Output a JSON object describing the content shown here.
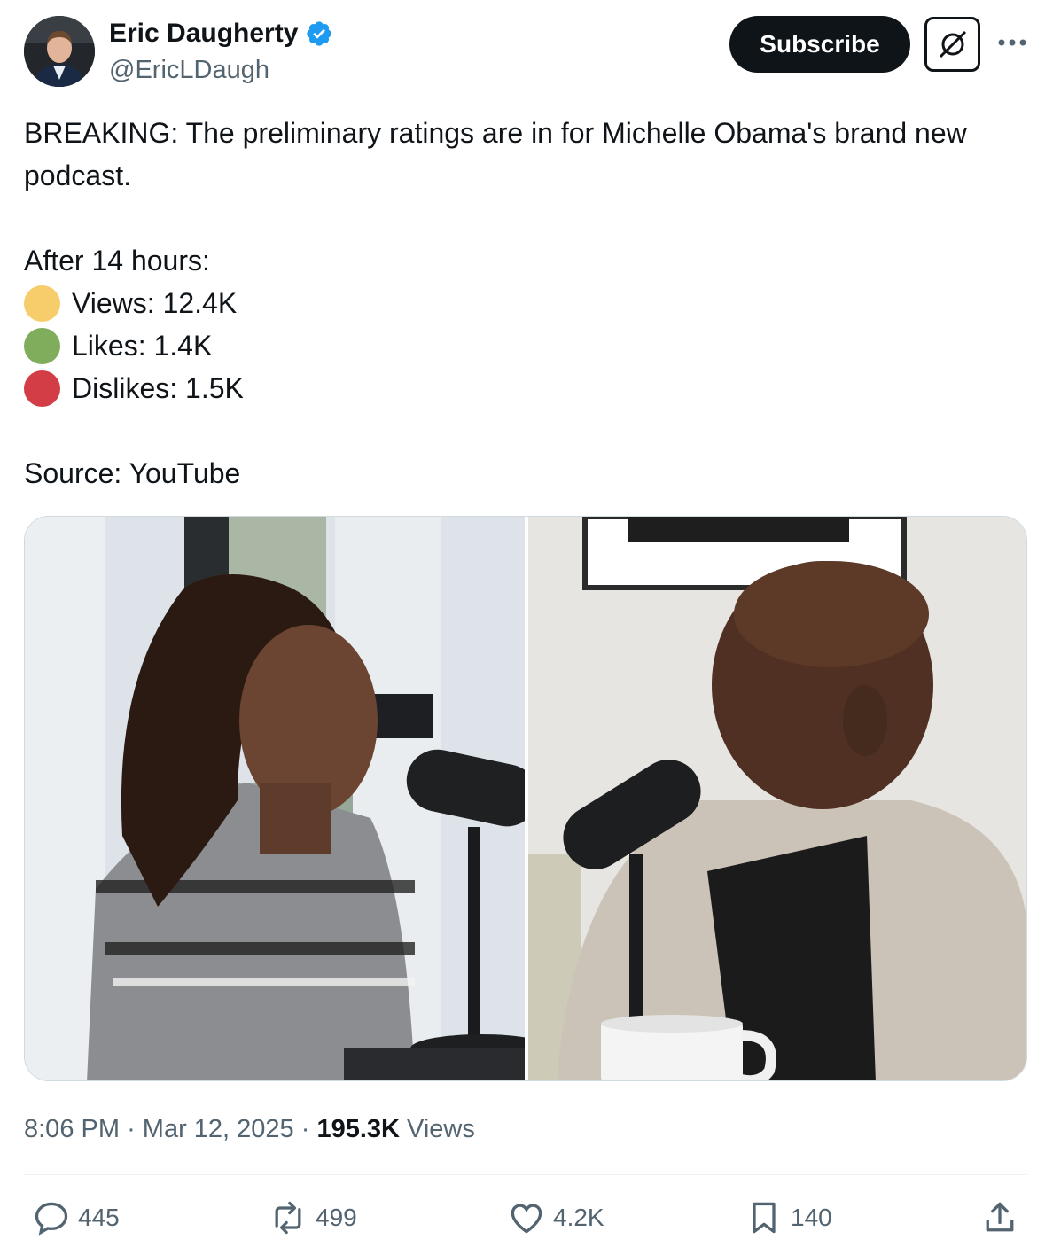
{
  "author": {
    "display_name": "Eric Daugherty",
    "handle": "@EricLDaugh",
    "verified": true
  },
  "header_actions": {
    "subscribe_label": "Subscribe"
  },
  "post": {
    "text_line_1": "BREAKING: The preliminary ratings are in for Michelle Obama's brand new podcast.",
    "text_line_2": "After 14 hours:",
    "stats": [
      {
        "label": "Views: 12.4K",
        "color": "#f6cd6a"
      },
      {
        "label": "Likes: 1.4K",
        "color": "#7fad5b"
      },
      {
        "label": "Dislikes: 1.5K",
        "color": "#d23d46"
      }
    ],
    "source": "Source: YouTube"
  },
  "meta": {
    "time": "8:06 PM",
    "date": "Mar 12, 2025",
    "views_count": "195.3K",
    "views_label": "Views"
  },
  "actions": {
    "replies": "445",
    "reposts": "499",
    "likes": "4.2K",
    "bookmarks": "140"
  },
  "colors": {
    "text": "#0f1419",
    "secondary": "#536471",
    "verified": "#1d9bf0"
  },
  "icons": [
    "verified-badge-icon",
    "grok-icon",
    "more-icon",
    "reply-icon",
    "repost-icon",
    "like-icon",
    "bookmark-icon",
    "share-icon"
  ]
}
